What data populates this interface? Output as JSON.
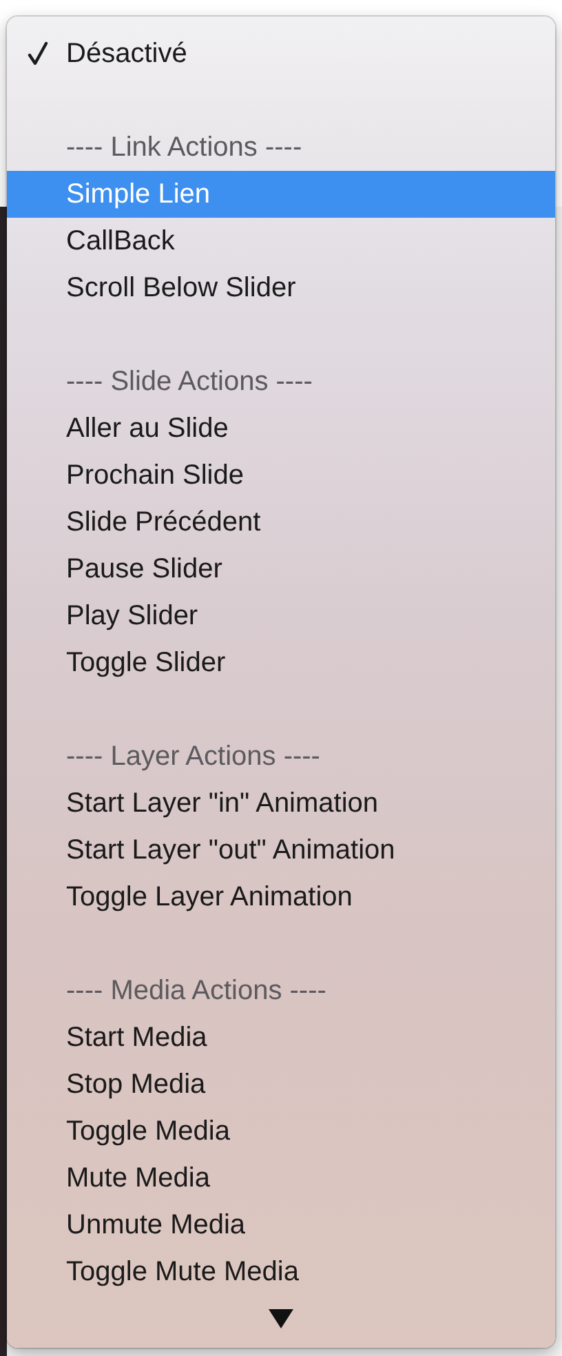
{
  "menu": {
    "items": [
      {
        "kind": "item",
        "label": "Désactivé",
        "checked": true,
        "selected": false
      },
      {
        "kind": "gap"
      },
      {
        "kind": "header",
        "label": "---- Link Actions ----"
      },
      {
        "kind": "item",
        "label": "Simple Lien",
        "checked": false,
        "selected": true
      },
      {
        "kind": "item",
        "label": "CallBack",
        "checked": false,
        "selected": false
      },
      {
        "kind": "item",
        "label": "Scroll Below Slider",
        "checked": false,
        "selected": false
      },
      {
        "kind": "gap"
      },
      {
        "kind": "header",
        "label": "---- Slide Actions ----"
      },
      {
        "kind": "item",
        "label": "Aller au Slide",
        "checked": false,
        "selected": false
      },
      {
        "kind": "item",
        "label": "Prochain Slide",
        "checked": false,
        "selected": false
      },
      {
        "kind": "item",
        "label": "Slide Précédent",
        "checked": false,
        "selected": false
      },
      {
        "kind": "item",
        "label": "Pause Slider",
        "checked": false,
        "selected": false
      },
      {
        "kind": "item",
        "label": "Play Slider",
        "checked": false,
        "selected": false
      },
      {
        "kind": "item",
        "label": "Toggle Slider",
        "checked": false,
        "selected": false
      },
      {
        "kind": "gap"
      },
      {
        "kind": "header",
        "label": "---- Layer Actions ----"
      },
      {
        "kind": "item",
        "label": "Start Layer \"in\" Animation",
        "checked": false,
        "selected": false
      },
      {
        "kind": "item",
        "label": "Start Layer \"out\" Animation",
        "checked": false,
        "selected": false
      },
      {
        "kind": "item",
        "label": "Toggle Layer Animation",
        "checked": false,
        "selected": false
      },
      {
        "kind": "gap"
      },
      {
        "kind": "header",
        "label": "---- Media Actions ----"
      },
      {
        "kind": "item",
        "label": "Start Media",
        "checked": false,
        "selected": false
      },
      {
        "kind": "item",
        "label": "Stop Media",
        "checked": false,
        "selected": false
      },
      {
        "kind": "item",
        "label": "Toggle Media",
        "checked": false,
        "selected": false
      },
      {
        "kind": "item",
        "label": "Mute Media",
        "checked": false,
        "selected": false
      },
      {
        "kind": "item",
        "label": "Unmute Media",
        "checked": false,
        "selected": false
      },
      {
        "kind": "item",
        "label": "Toggle Mute Media",
        "checked": false,
        "selected": false
      }
    ],
    "more_below": true
  }
}
